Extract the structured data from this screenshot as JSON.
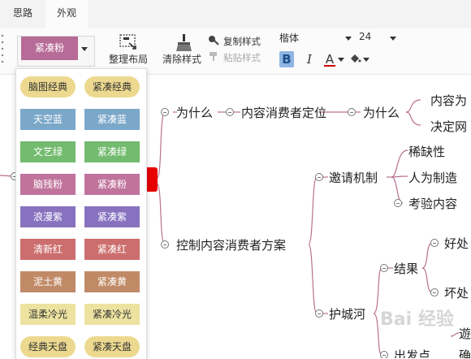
{
  "tabs": [
    {
      "label": "思路"
    },
    {
      "label": "外观"
    }
  ],
  "theme": {
    "label": "紧凑粉"
  },
  "toolbar": {
    "organize_label": "整理布局",
    "clear_style_label": "清除样式",
    "copy_style_label": "复制样式",
    "paste_style_label": "粘贴样式",
    "font_family": "楷体",
    "font_size": "24",
    "bold": "B",
    "italic": "I",
    "font_color": "A"
  },
  "theme_list": [
    {
      "label": "脑图经典",
      "bg": "#ecd98f",
      "fg": "#333333",
      "pill": true
    },
    {
      "label": "紧凑经典",
      "bg": "#ecd98f",
      "fg": "#333333",
      "pill": true
    },
    {
      "label": "天空蓝",
      "bg": "#7ba8c9",
      "fg": "#ffffff",
      "pill": false
    },
    {
      "label": "紧凑蓝",
      "bg": "#7ba8c9",
      "fg": "#ffffff",
      "pill": false
    },
    {
      "label": "文艺绿",
      "bg": "#73bb6e",
      "fg": "#ffffff",
      "pill": false
    },
    {
      "label": "紧凑绿",
      "bg": "#73bb6e",
      "fg": "#ffffff",
      "pill": false
    },
    {
      "label": "脑残粉",
      "bg": "#c0749c",
      "fg": "#ffffff",
      "pill": false
    },
    {
      "label": "紧凑粉",
      "bg": "#c0749c",
      "fg": "#ffffff",
      "pill": false
    },
    {
      "label": "浪漫紫",
      "bg": "#8872c0",
      "fg": "#ffffff",
      "pill": false
    },
    {
      "label": "紧凑紫",
      "bg": "#8872c0",
      "fg": "#ffffff",
      "pill": false
    },
    {
      "label": "清新红",
      "bg": "#cd6e6e",
      "fg": "#ffffff",
      "pill": false
    },
    {
      "label": "紧凑红",
      "bg": "#cd6e6e",
      "fg": "#ffffff",
      "pill": false
    },
    {
      "label": "泥土黄",
      "bg": "#c18a66",
      "fg": "#ffffff",
      "pill": false
    },
    {
      "label": "紧凑黄",
      "bg": "#c18a66",
      "fg": "#ffffff",
      "pill": false
    },
    {
      "label": "温柔冷光",
      "bg": "#ede3a1",
      "fg": "#333333",
      "pill": false
    },
    {
      "label": "紧凑冷光",
      "bg": "#ede3a1",
      "fg": "#333333",
      "pill": false
    },
    {
      "label": "经典天盘",
      "bg": "#ecd98f",
      "fg": "#333333",
      "pill": true
    },
    {
      "label": "紧凑天盘",
      "bg": "#ecd98f",
      "fg": "#333333",
      "pill": true
    }
  ],
  "mindmap": {
    "n1": "为什么",
    "n2": "内容消费者定位",
    "n3": "为什么",
    "n4": "内容为",
    "n5": "决定网",
    "n6": "邀请机制",
    "n7": "稀缺性",
    "n8": "人为制造",
    "n9": "考验内容",
    "n10": "控制内容消费者方案",
    "n11": "结果",
    "n12": "好处",
    "n13": "坏处",
    "n14": "护城河",
    "n15": "遊",
    "n16": "出发点",
    "n17": "确"
  },
  "watermark": "Bai 经验"
}
